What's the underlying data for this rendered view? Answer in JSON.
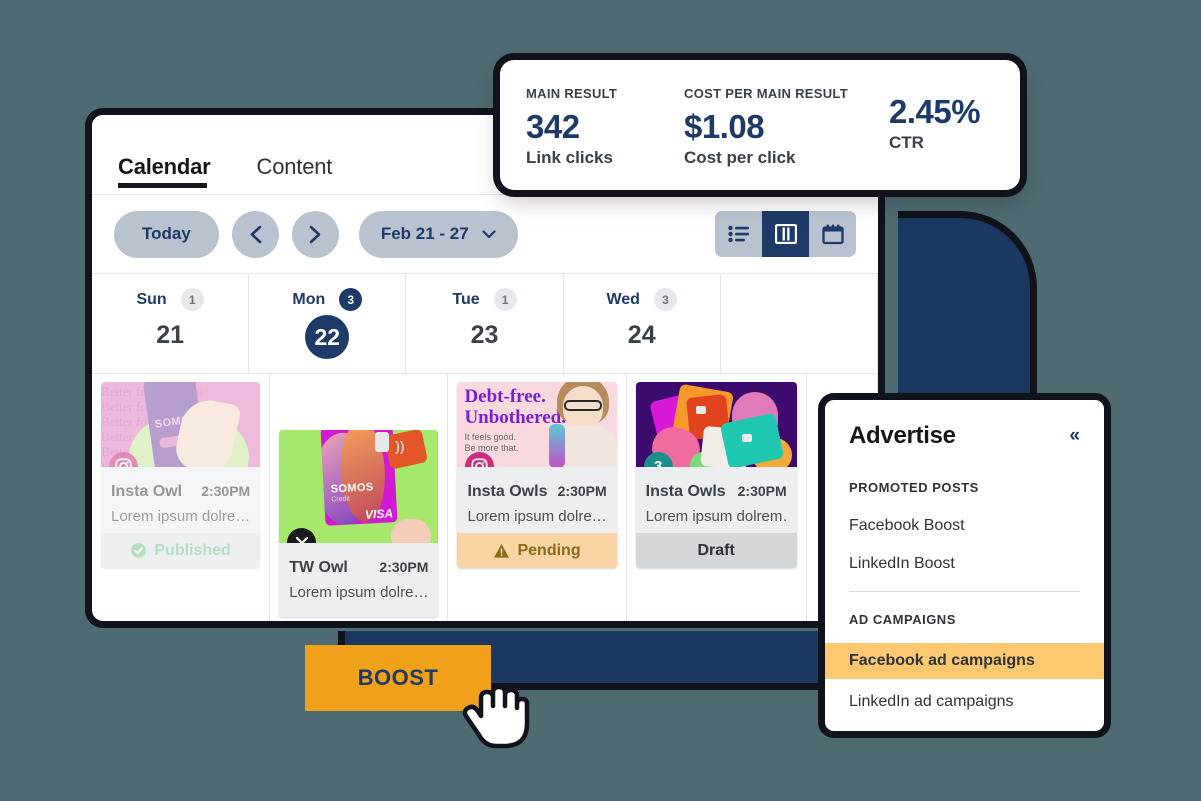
{
  "metrics": {
    "items": [
      {
        "label": "MAIN RESULT",
        "value": "342",
        "sub": "Link clicks"
      },
      {
        "label": "COST PER MAIN RESULT",
        "value": "$1.08",
        "sub": "Cost per click"
      },
      {
        "label": "",
        "value": "2.45%",
        "sub": "CTR"
      }
    ]
  },
  "tabs": [
    {
      "label": "Calendar",
      "active": true
    },
    {
      "label": "Content",
      "active": false
    }
  ],
  "toolbar": {
    "today_label": "Today",
    "prev_icon": "chevron-left-icon",
    "next_icon": "chevron-right-icon",
    "range_label": "Feb 21 - 27",
    "range_chevron": "chevron-down-icon",
    "views": [
      {
        "name": "list-view",
        "icon": "list-icon",
        "active": false
      },
      {
        "name": "column-view",
        "icon": "columns-icon",
        "active": true
      },
      {
        "name": "month-view",
        "icon": "calendar-icon",
        "active": false
      }
    ]
  },
  "calendar": {
    "days": [
      {
        "name": "Sun",
        "num": "21",
        "count": "1",
        "today": false
      },
      {
        "name": "Mon",
        "num": "22",
        "count": "3",
        "today": true
      },
      {
        "name": "Tue",
        "num": "23",
        "count": "1",
        "today": false
      },
      {
        "name": "Wed",
        "num": "24",
        "count": "3",
        "today": false
      }
    ],
    "posts": [
      {
        "network": "instagram",
        "author": "Insta Owl",
        "time": "2:30PM",
        "text": "Lorem ipsum dolre…",
        "status": "Published",
        "status_icon": "check-circle-icon",
        "art_headline": "Better for everyone",
        "art_brand": "SOMOS"
      },
      {
        "network": "x",
        "author": "TW Owl",
        "time": "2:30PM",
        "text": "Lorem ipsum dolre…",
        "status": "",
        "status_icon": "",
        "art_brand": "SOMOS",
        "art_brand_sub": "Credit",
        "art_visa": "VISA"
      },
      {
        "network": "instagram",
        "author": "Insta Owls",
        "time": "2:30PM",
        "text": "Lorem ipsum dolre…",
        "status": "Pending",
        "status_icon": "warning-triangle-icon",
        "art_headline": "Debt-free.",
        "art_headline2": "Unbothered.",
        "art_sub": "It feels good.",
        "art_sub2": "Be more that."
      },
      {
        "network": "count",
        "count_badge": "3",
        "author": "Insta Owls",
        "time": "2:30PM",
        "text": "Lorem ipsum dolrem…",
        "status": "Draft",
        "status_icon": ""
      }
    ]
  },
  "advertise": {
    "title": "Advertise",
    "collapse_icon": "chevron-double-left-icon",
    "section1": "PROMOTED POSTS",
    "items1": [
      "Facebook Boost",
      "LinkedIn Boost"
    ],
    "section2": "AD CAMPAIGNS",
    "items2": [
      {
        "label": "Facebook ad campaigns",
        "highlighted": true
      },
      {
        "label": "LinkedIn ad campaigns",
        "highlighted": false
      }
    ]
  },
  "boost": {
    "label": "BOOST"
  },
  "colors": {
    "background": "#4e6a72",
    "navy": "#1b3862",
    "accent_orange": "#f0a019",
    "highlight": "#fbc870",
    "pill": "#b9c3d0"
  }
}
